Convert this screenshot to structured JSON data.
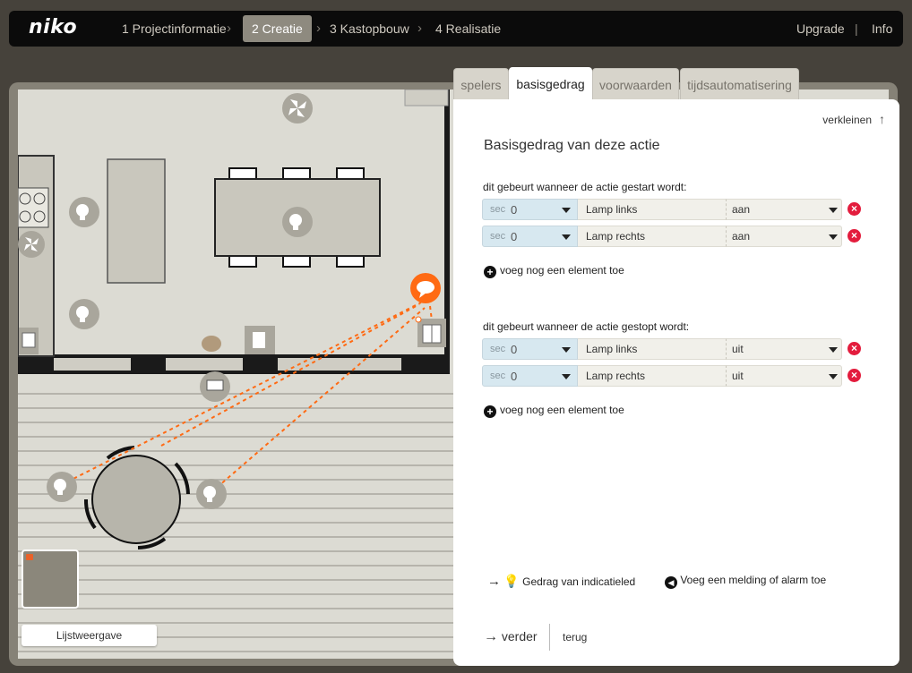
{
  "app": {
    "logo": "niko"
  },
  "nav": {
    "steps": [
      "1 Projectinformatie",
      "2 Creatie",
      "3 Kastopbouw",
      "4 Realisatie"
    ],
    "active_step": 1,
    "upgrade": "Upgrade",
    "separator": "|",
    "info": "Info"
  },
  "tabs": [
    "spelers",
    "basisgedrag",
    "voorwaarden",
    "tijdsautomatisering"
  ],
  "active_tab": "basisgedrag",
  "panel": {
    "collapse_label": "verkleinen",
    "title": "Basisgedrag van deze actie",
    "start_section": {
      "label": "dit gebeurt wanneer de actie gestart wordt:",
      "rows": [
        {
          "unit": "sec",
          "value": "0",
          "element": "Lamp links",
          "state": "aan"
        },
        {
          "unit": "sec",
          "value": "0",
          "element": "Lamp rechts",
          "state": "aan"
        }
      ],
      "add_label": "voeg nog een element toe"
    },
    "stop_section": {
      "label": "dit gebeurt wanneer de actie gestopt wordt:",
      "rows": [
        {
          "unit": "sec",
          "value": "0",
          "element": "Lamp links",
          "state": "uit"
        },
        {
          "unit": "sec",
          "value": "0",
          "element": "Lamp rechts",
          "state": "uit"
        }
      ],
      "add_label": "voeg nog een element toe"
    },
    "indicator_label": "Gedrag van indicatieled",
    "alarm_label": "Voeg een melding of alarm toe",
    "next_label": "verder",
    "back_label": "terug"
  },
  "plan": {
    "list_view_label": "Lijstweergave"
  },
  "colors": {
    "accent_orange": "#ff6a13",
    "delete_red": "#e31c3d",
    "active_step_bg": "#8e8a7f",
    "sec_field_bg": "#d7e8f0"
  },
  "icons": [
    "search-icon",
    "chevron-right-icon",
    "arrow-up-icon",
    "close-icon",
    "plus-icon",
    "arrow-right-icon",
    "indicator-led-icon",
    "alarm-icon",
    "lamp-icon",
    "fan-icon",
    "switch-icon",
    "speech-bubble-icon"
  ]
}
